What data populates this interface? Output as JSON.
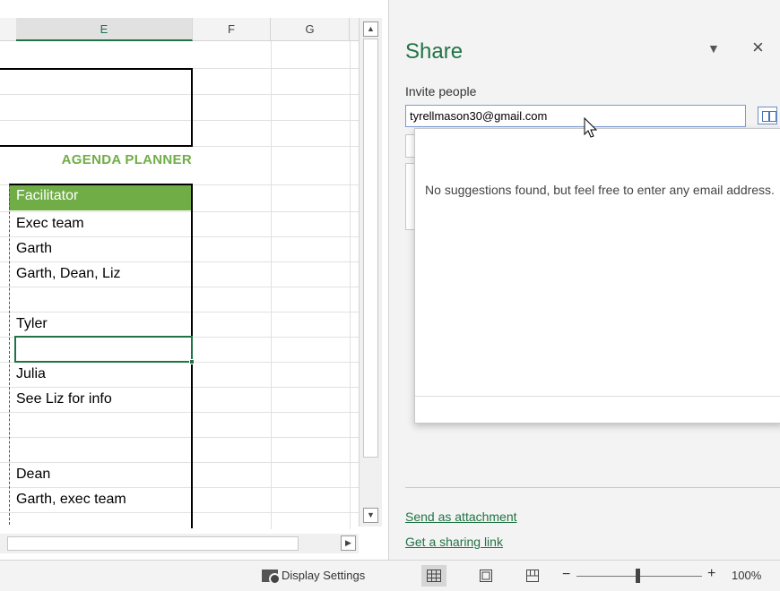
{
  "columns": [
    "E",
    "F",
    "G"
  ],
  "sheet": {
    "title_cell": "AGENDA PLANNER",
    "header_cell": "Facilitator",
    "rows": [
      "Exec team",
      "Garth",
      "Garth, Dean, Liz",
      "",
      "Tyler",
      "",
      "Julia",
      "See Liz for info",
      "",
      "",
      "Dean",
      "Garth, exec team"
    ]
  },
  "share": {
    "title": "Share",
    "menu_icon": "dropdown-triangle",
    "close_label": "×",
    "invite_label": "Invite people",
    "invite_value": "tyrellmason30@gmail.com",
    "suggestion_text": "No suggestions found, but feel free to enter any email address.",
    "send_attachment": "Send as attachment",
    "sharing_link": "Get a sharing link"
  },
  "status": {
    "display_settings": "Display Settings",
    "zoom_minus": "−",
    "zoom_plus": "+",
    "zoom": "100%"
  },
  "colors": {
    "accent": "#217346",
    "table_green": "#70ad47"
  }
}
